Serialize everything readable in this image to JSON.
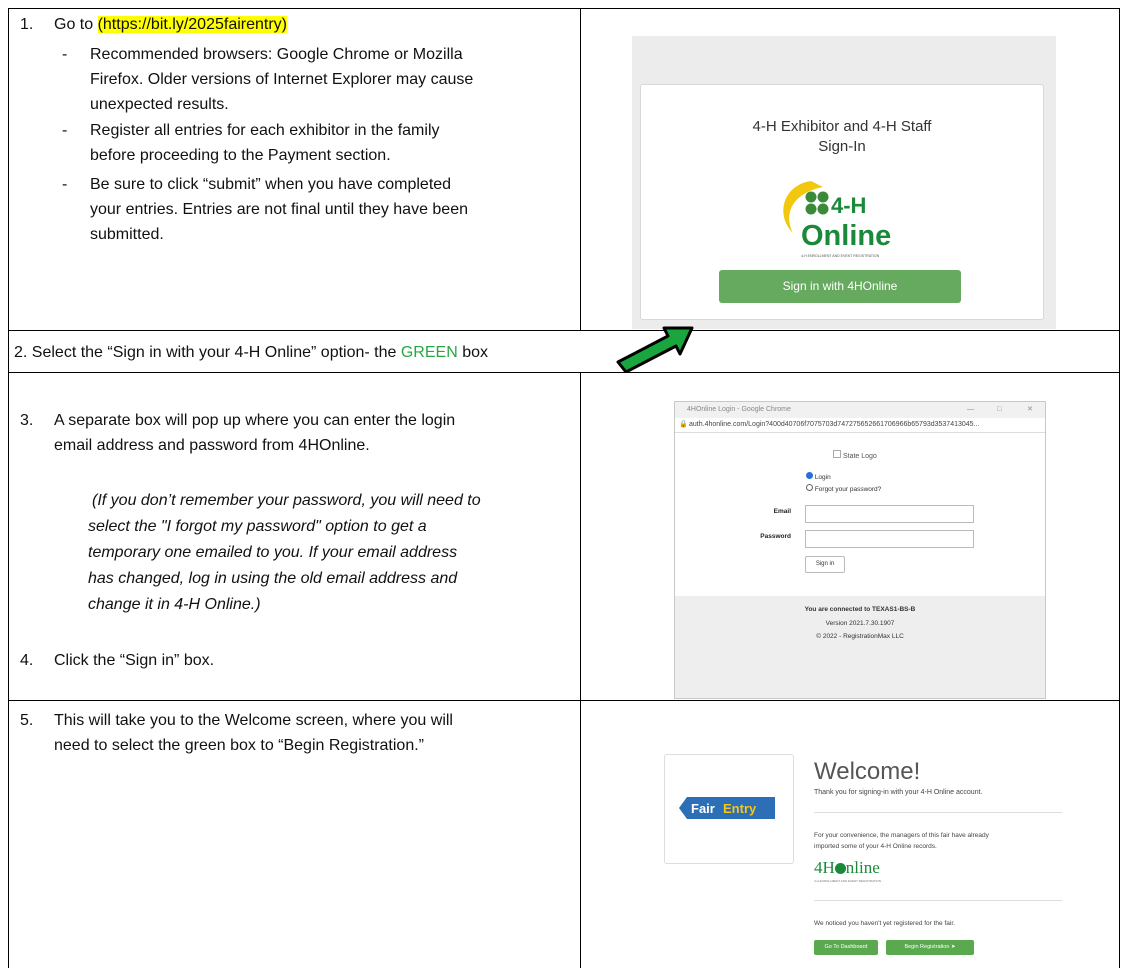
{
  "step1": {
    "num": "1.",
    "prefix": "Go to ",
    "link": "(https://bit.ly/2025fairentry)",
    "bullets": [
      [
        "Recommended browsers: Google Chrome or Mozilla",
        "Firefox. Older versions of Internet Explorer may cause",
        "unexpected results."
      ],
      [
        "Register all entries for each exhibitor in the family",
        "before proceeding to the Payment section."
      ],
      [
        "Be sure to click “submit” when you have completed",
        "your entries. Entries are not final until they have been",
        "submitted."
      ]
    ]
  },
  "signin_panel": {
    "title_line1": "4-H Exhibitor and 4-H Staff",
    "title_line2": "Sign-In",
    "logo_top": "4-H",
    "logo_bottom": "Online",
    "logo_tagline": "4-H ENROLLMENT AND EVENT REGISTRATION",
    "button": "Sign in with 4HOnline"
  },
  "step2": {
    "text_before": "2. Select the “Sign in with your 4-H Online” option- the ",
    "green_word": "GREEN",
    "text_after": " box"
  },
  "step3": {
    "num": "3.",
    "lines": [
      "A separate box will pop up where you can enter the login",
      "email address and password from 4HOnline."
    ],
    "italic_lines": [
      "(If you don’t remember your password, you will need to",
      "select the \"I forgot my password\" option to get a",
      "temporary one emailed to you.  If your email address",
      "has changed, log in using the old email address and",
      "change it in 4-H Online.)"
    ]
  },
  "step4": {
    "num": "4.",
    "text": "Click the “Sign in” box."
  },
  "login_popup": {
    "window_title": "4HOnline Login - Google Chrome",
    "url": "auth.4honline.com/Login?400d40706f7075703d747275652661706966b65793d3537413045...",
    "state_logo_alt": "State Logo",
    "option_login": "Login",
    "option_forgot": "Forgot your password?",
    "email_label": "Email",
    "password_label": "Password",
    "sign_in_button": "Sign in",
    "connected": "You are connected to TEXAS1-BS-B",
    "version": "Version 2021.7.30.1907",
    "copyright": "© 2022 - RegistrationMax LLC"
  },
  "step5": {
    "num": "5.",
    "lines": [
      "This will take you to the Welcome screen, where you will",
      "need to select the green box to “Begin Registration.”"
    ]
  },
  "welcome_screen": {
    "logo_fair": "Fair",
    "logo_entry": "Entry",
    "heading": "Welcome!",
    "thanks": "Thank you for signing-in with your 4-H Online account.",
    "convenience_line1": "For your convenience, the managers of this fair have already",
    "convenience_line2": "imported some of your 4-H Online records.",
    "logo_4h_a": "4H",
    "logo_4h_b": "nline",
    "logo_4h_tagline": "4-H ENROLLMENT AND EVENT REGISTRATION",
    "noticed": "We noticed you haven't yet registered for the fair.",
    "btn_dashboard": "Go To Dashboard",
    "btn_begin": "Begin Registration"
  }
}
